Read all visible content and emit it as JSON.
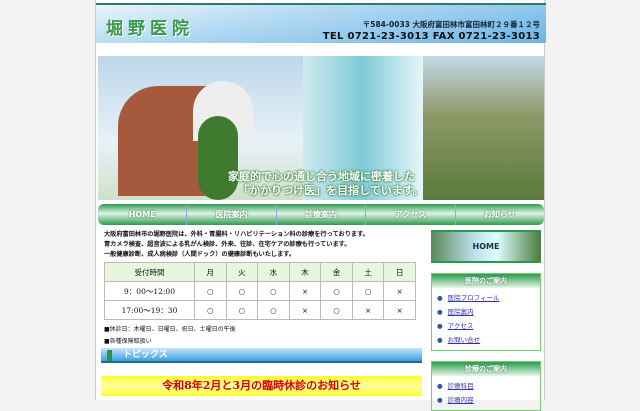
{
  "header": {
    "logo": "堀野医院",
    "address": "〒584-0033 大阪府富田林市富田林町２９番１２号",
    "tel": "TEL 0721-23-3013 FAX 0721-23-3013"
  },
  "banner": {
    "line1": "家庭的で心の通じ合う地域に密着した",
    "line2": "「かかりつけ医」を目指しています。"
  },
  "nav": [
    "HOME",
    "医院案内",
    "診療案内",
    "アクセス",
    "お知らせ"
  ],
  "intro": [
    "大阪府富田林市の堀野医院は、外科・胃腸科・リハビリテーション科の診療を行っております。",
    "胃カメラ検査、超音波による乳がん検診、外来、往診、在宅ケアの診療も行っています。",
    "一般健康診断、成人病検診（人間ドック）の健康診断もいたします。"
  ],
  "schedule": {
    "headers": [
      "受付時間",
      "月",
      "火",
      "水",
      "木",
      "金",
      "土",
      "日"
    ],
    "rows": [
      [
        "9：00～12:00",
        "○",
        "○",
        "○",
        "×",
        "○",
        "○",
        "×"
      ],
      [
        "17:00～19：30",
        "○",
        "○",
        "○",
        "×",
        "○",
        "×",
        "×"
      ]
    ]
  },
  "notes": [
    "■休診日：木曜日、日曜日、祝日、土曜日の午後",
    "■各種保険取扱い"
  ],
  "topics": {
    "title": "トピックス",
    "notice": "令和8年2月と3月の臨時休診のお知らせ"
  },
  "sidebar": {
    "home": "HOME",
    "clinic": {
      "title": "医院のご案内",
      "items": [
        "医院プロフィール",
        "医院案内",
        "アクセス",
        "お問い合せ"
      ]
    },
    "medical": {
      "title": "診療のご案内",
      "items": [
        "診療科目",
        "診療内容"
      ]
    }
  }
}
